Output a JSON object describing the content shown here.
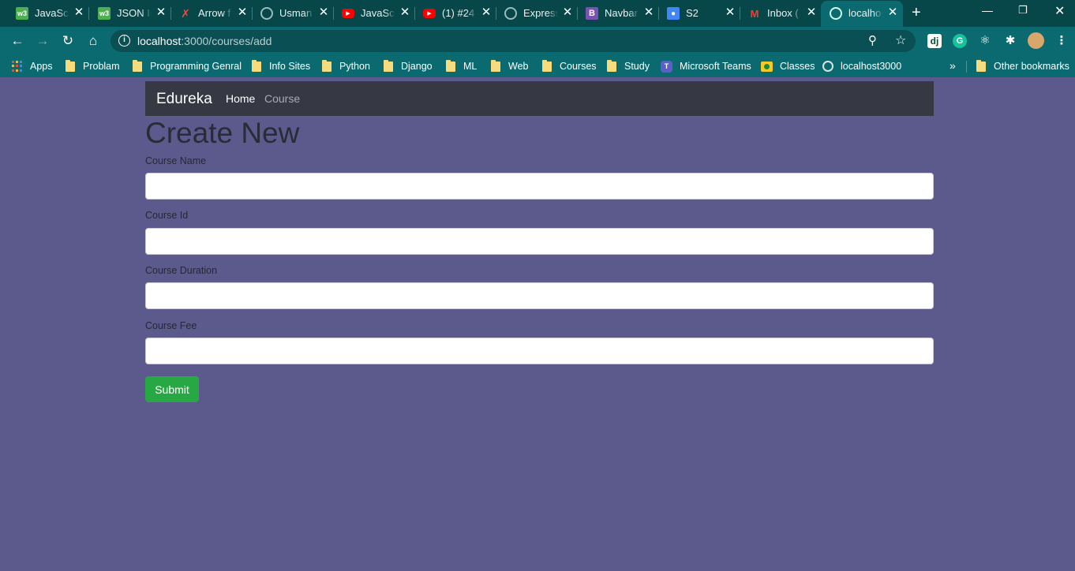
{
  "browser": {
    "tabs": [
      {
        "label": "JavaScr",
        "icon": "w3schools-icon",
        "color": "#4caf50"
      },
      {
        "label": "JSON Ir",
        "icon": "w3schools-icon",
        "color": "#4caf50"
      },
      {
        "label": "Arrow f",
        "icon": "arrow-icon",
        "color": "#c0392b"
      },
      {
        "label": "Usman",
        "icon": "globe-icon",
        "color": "#8aa"
      },
      {
        "label": "JavaScr",
        "icon": "youtube-icon",
        "color": "#ff0000"
      },
      {
        "label": "(1) #24",
        "icon": "youtube-icon",
        "color": "#ff0000"
      },
      {
        "label": "Express",
        "icon": "globe-icon",
        "color": "#8aa"
      },
      {
        "label": "Navbar",
        "icon": "bootstrap-icon",
        "color": "#7952b3"
      },
      {
        "label": "S2",
        "icon": "contacts-icon",
        "color": "#4285f4"
      },
      {
        "label": "Inbox (",
        "icon": "gmail-icon",
        "color": "#ea4335"
      },
      {
        "label": "localho",
        "icon": "globe-icon",
        "color": "#8aa",
        "active": true
      }
    ],
    "url_host": "localhost",
    "url_path": ":3000/courses/add",
    "bookmarks": [
      {
        "label": "Apps",
        "icon": "apps-grid-icon"
      },
      {
        "label": "Problam",
        "icon": "folder-icon"
      },
      {
        "label": "Programming Genral",
        "icon": "folder-icon"
      },
      {
        "label": "Info Sites",
        "icon": "folder-icon"
      },
      {
        "label": "Python",
        "icon": "folder-icon"
      },
      {
        "label": "Django",
        "icon": "folder-icon"
      },
      {
        "label": "ML",
        "icon": "folder-icon"
      },
      {
        "label": "Web",
        "icon": "folder-icon"
      },
      {
        "label": "Courses",
        "icon": "folder-icon"
      },
      {
        "label": "Study",
        "icon": "folder-icon"
      },
      {
        "label": "Microsoft Teams",
        "icon": "teams-icon"
      },
      {
        "label": "Classes",
        "icon": "classroom-icon"
      },
      {
        "label": "localhost3000",
        "icon": "globe-icon"
      }
    ],
    "other_bookmarks": "Other bookmarks",
    "extensions": {
      "django": "dj",
      "grammarly": "G"
    }
  },
  "page": {
    "brand": "Edureka",
    "nav": {
      "home": "Home",
      "course": "Course"
    },
    "heading": "Create New",
    "fields": {
      "course_name": {
        "label": "Course Name",
        "value": ""
      },
      "course_id": {
        "label": "Course Id",
        "value": ""
      },
      "course_duration": {
        "label": "Course Duration",
        "value": ""
      },
      "course_fee": {
        "label": "Course Fee",
        "value": ""
      }
    },
    "submit": "Submit"
  },
  "colors": {
    "page_bg": "#5c5a8c",
    "navbar_bg": "#363944",
    "submit_bg": "#28a745",
    "chrome_bg": "#0b6a70",
    "tabstrip_bg": "#07474a"
  }
}
